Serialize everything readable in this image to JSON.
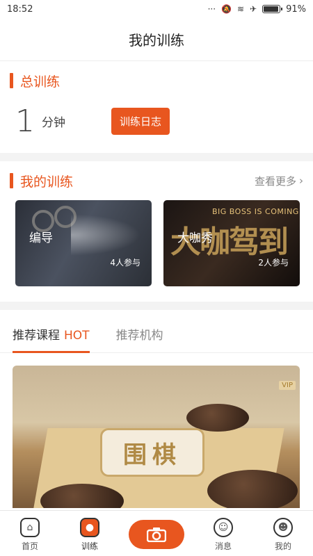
{
  "status": {
    "time": "18:52",
    "battery": "91%",
    "battery_level": 0.91
  },
  "header": {
    "title": "我的训练"
  },
  "total": {
    "title": "总训练",
    "value": "1",
    "unit": "分钟",
    "log_button": "训练日志"
  },
  "my_training": {
    "title": "我的训练",
    "more": "查看更多",
    "items": [
      {
        "name": "编导",
        "count": "4人参与"
      },
      {
        "name": "大咖秀",
        "count": "2人参与",
        "banner_text": "BIG BOSS IS COMING",
        "banner_big": "大咖驾到"
      }
    ]
  },
  "recommend": {
    "tabs": [
      {
        "label": "推荐课程",
        "badge": "HOT"
      },
      {
        "label": "推荐机构"
      }
    ],
    "course": {
      "title": "围棋",
      "tag": "VIP"
    }
  },
  "nav": {
    "home": "首页",
    "training": "训练",
    "messages": "消息",
    "mine": "我的"
  }
}
